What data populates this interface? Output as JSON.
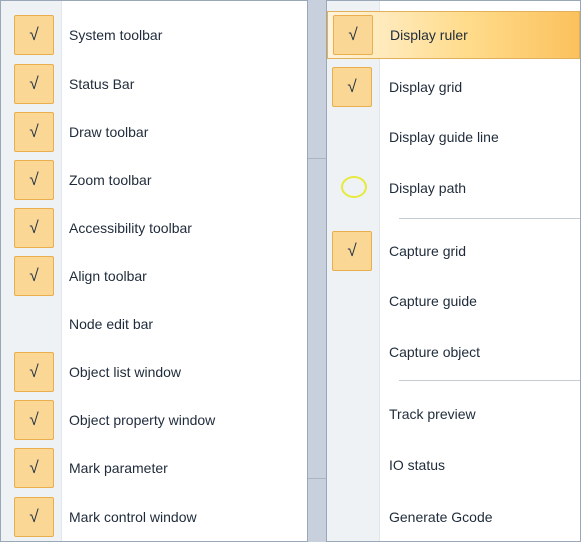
{
  "left_menu": {
    "items": [
      {
        "label": "System toolbar",
        "checked": true
      },
      {
        "label": "Status Bar",
        "checked": true
      },
      {
        "label": "Draw toolbar",
        "checked": true
      },
      {
        "label": "Zoom toolbar",
        "checked": true
      },
      {
        "label": "Accessibility toolbar",
        "checked": true
      },
      {
        "label": "Align toolbar",
        "checked": true
      },
      {
        "label": "Node edit bar",
        "checked": false
      },
      {
        "label": "Object list window",
        "checked": true
      },
      {
        "label": "Object property window",
        "checked": true
      },
      {
        "label": "Mark parameter",
        "checked": true
      },
      {
        "label": "Mark control window",
        "checked": true
      }
    ]
  },
  "right_menu": {
    "items": [
      {
        "label": "Display ruler",
        "checked": true,
        "highlighted": true
      },
      {
        "label": "Display grid",
        "checked": true
      },
      {
        "label": "Display guide line",
        "checked": false
      },
      {
        "label": "Display path",
        "checked": false,
        "icon": "path-circle-icon"
      },
      {
        "label": "Capture grid",
        "checked": true
      },
      {
        "label": "Capture guide",
        "checked": false
      },
      {
        "label": "Capture object",
        "checked": false
      },
      {
        "label": "Track preview",
        "checked": false
      },
      {
        "label": "IO status",
        "checked": false
      },
      {
        "label": "Generate Gcode",
        "checked": false
      }
    ]
  },
  "check_glyph": "√",
  "colors": {
    "check_fill": "#fbd796",
    "check_border": "#e9ae4e",
    "highlight_end": "#fbc15d",
    "path_ring": "#e6ea3a"
  }
}
